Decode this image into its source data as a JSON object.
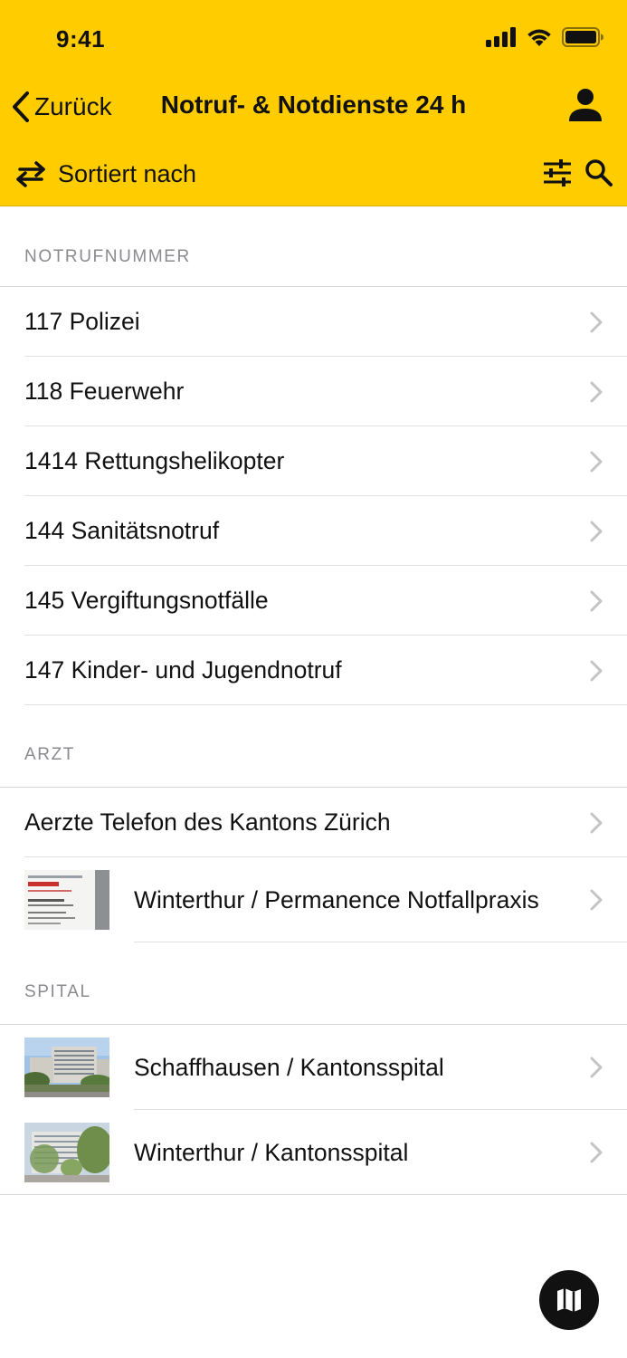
{
  "status_bar": {
    "time": "9:41"
  },
  "nav": {
    "back_label": "Zurück",
    "title": "Notruf- & Notdienste 24 h"
  },
  "sortbar": {
    "sort_label": "Sortiert nach"
  },
  "sections": {
    "notruf": {
      "title": "NOTRUFNUMMER",
      "items": [
        {
          "label": "117 Polizei"
        },
        {
          "label": "118 Feuerwehr"
        },
        {
          "label": "1414 Rettungshelikopter"
        },
        {
          "label": "144 Sanitätsnotruf"
        },
        {
          "label": "145 Vergiftungsnotfälle"
        },
        {
          "label": "147 Kinder- und Jugendnotruf"
        }
      ]
    },
    "arzt": {
      "title": "ARZT",
      "items": [
        {
          "label": "Aerzte Telefon des Kantons Zürich"
        },
        {
          "label": "Winterthur / Permanence Notfallpraxis"
        }
      ]
    },
    "spital": {
      "title": "SPITAL",
      "items": [
        {
          "label": "Schaffhausen / Kantonsspital"
        },
        {
          "label": "Winterthur / Kantonsspital"
        }
      ]
    }
  },
  "colors": {
    "accent": "#FFCC00",
    "text": "#111111",
    "section_header": "#8A8A8F",
    "chevron": "#C4C4C6"
  },
  "icons": [
    "signal-icon",
    "wifi-icon",
    "battery-icon",
    "back-chevron-icon",
    "person-icon",
    "swap-arrows-icon",
    "filter-sliders-icon",
    "search-icon",
    "chevron-right-icon",
    "map-icon"
  ]
}
